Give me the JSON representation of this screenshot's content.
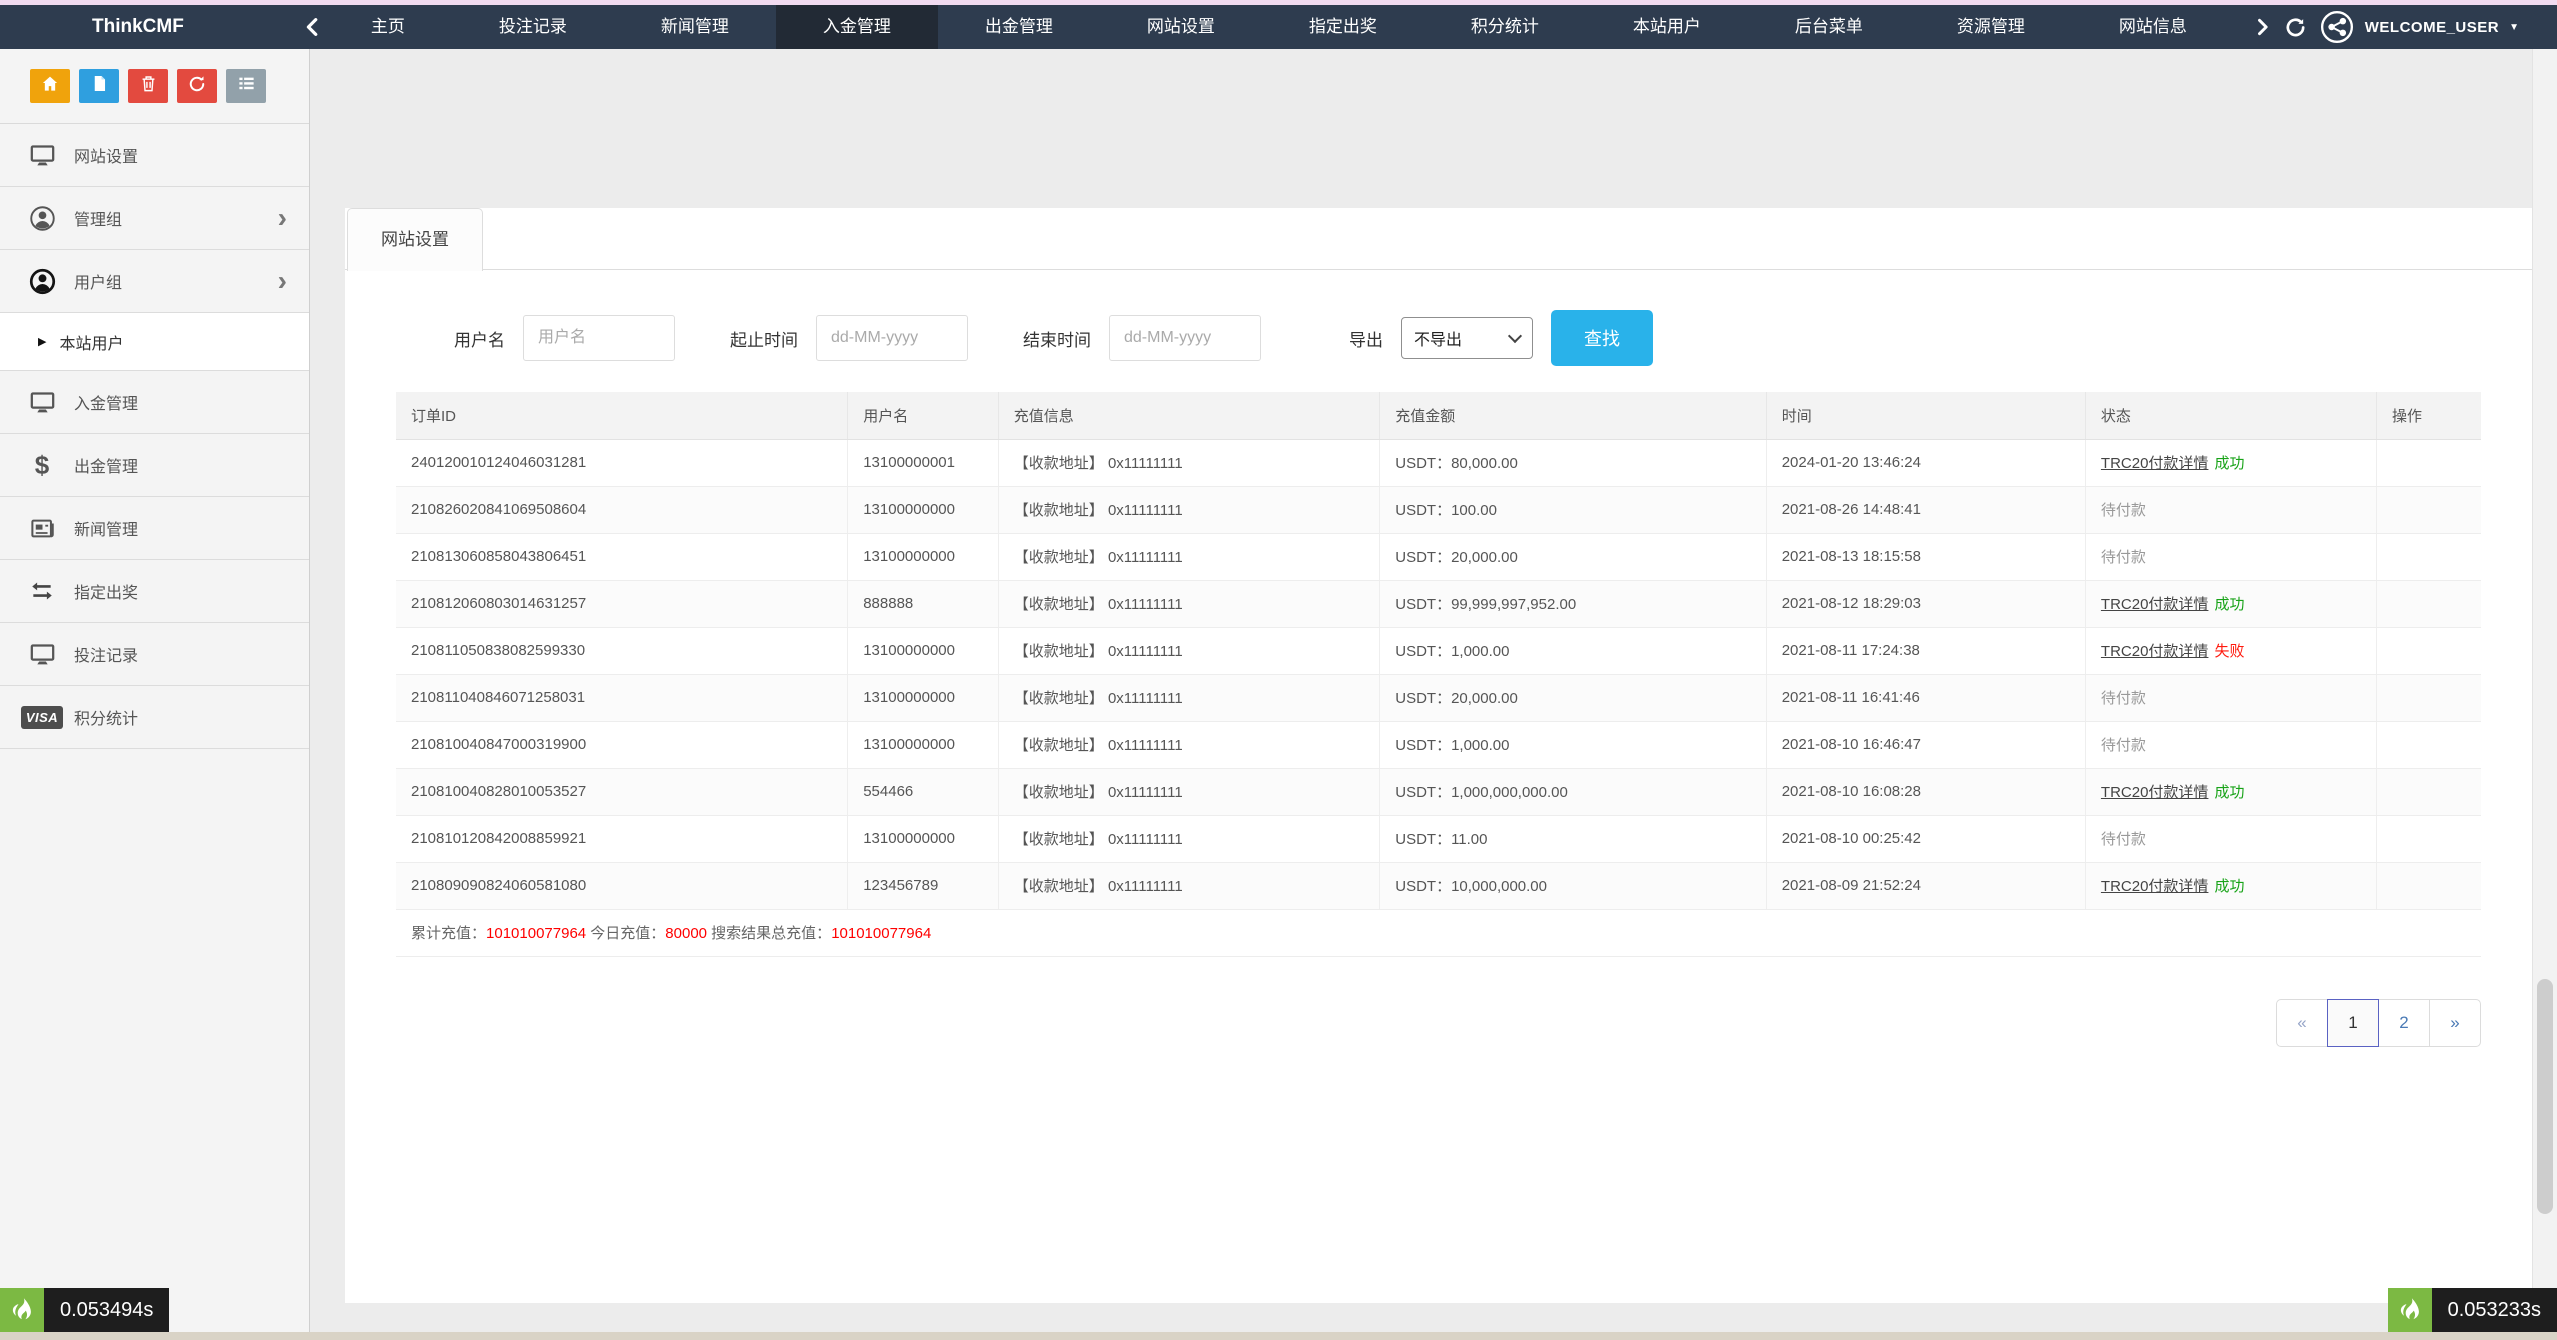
{
  "topnav": {
    "brand": "ThinkCMF",
    "items": [
      {
        "label": "主页",
        "active": false
      },
      {
        "label": "投注记录",
        "active": false
      },
      {
        "label": "新闻管理",
        "active": false
      },
      {
        "label": "入金管理",
        "active": true
      },
      {
        "label": "出金管理",
        "active": false
      },
      {
        "label": "网站设置",
        "active": false
      },
      {
        "label": "指定出奖",
        "active": false
      },
      {
        "label": "积分统计",
        "active": false
      },
      {
        "label": "本站用户",
        "active": false
      },
      {
        "label": "后台菜单",
        "active": false
      },
      {
        "label": "资源管理",
        "active": false
      },
      {
        "label": "网站信息",
        "active": false
      }
    ],
    "user": {
      "name": "WELCOME_USER",
      "caret": "▼"
    }
  },
  "sidebar": {
    "toolbar": [
      {
        "icon": "home-icon",
        "color": "#f0a30c"
      },
      {
        "icon": "file-icon",
        "color": "#2f9fdf"
      },
      {
        "icon": "trash-icon",
        "color": "#e34a3f"
      },
      {
        "icon": "recycle-icon",
        "color": "#e34a3f"
      },
      {
        "icon": "list-icon",
        "color": "#92a1aa"
      }
    ],
    "items": [
      {
        "icon": "monitor-icon",
        "label": "网站设置",
        "chevron": false,
        "sub": false,
        "active": false
      },
      {
        "icon": "user-circle-icon",
        "label": "管理组",
        "chevron": true,
        "sub": false,
        "active": false
      },
      {
        "icon": "user-circle-dark-icon",
        "label": "用户组",
        "chevron": true,
        "sub": false,
        "active": false
      },
      {
        "icon": "",
        "label": "本站用户",
        "chevron": false,
        "sub": true,
        "active": true
      },
      {
        "icon": "monitor-icon",
        "label": "入金管理",
        "chevron": false,
        "sub": false,
        "active": false
      },
      {
        "icon": "dollar-icon",
        "label": "出金管理",
        "chevron": false,
        "sub": false,
        "active": false
      },
      {
        "icon": "newspaper-icon",
        "label": "新闻管理",
        "chevron": false,
        "sub": false,
        "active": false
      },
      {
        "icon": "exchange-icon",
        "label": "指定出奖",
        "chevron": false,
        "sub": false,
        "active": false
      },
      {
        "icon": "monitor-icon",
        "label": "投注记录",
        "chevron": false,
        "sub": false,
        "active": false
      },
      {
        "icon": "visa-icon",
        "label": "积分统计",
        "chevron": false,
        "sub": false,
        "active": false
      }
    ]
  },
  "main": {
    "tab": "网站设置",
    "form": {
      "username_label": "用户名",
      "username_placeholder": "用户名",
      "start_label": "起止时间",
      "start_placeholder": "dd-MM-yyyy",
      "end_label": "结束时间",
      "end_placeholder": "dd-MM-yyyy",
      "export_label": "导出",
      "export_value": "不导出",
      "search_button": "查找"
    },
    "table": {
      "headers": [
        "订单ID",
        "用户名",
        "充值信息",
        "充值金额",
        "时间",
        "状态",
        "操作"
      ],
      "rows": [
        {
          "order_id": "240120010124046031281",
          "username": "13100000001",
          "info": "【收款地址】 0x11111111",
          "amount": "USDT：80,000.00",
          "time": "2024-01-20 13:46:24",
          "status": {
            "link": "TRC20付款详情",
            "result": "成功",
            "state": "success"
          }
        },
        {
          "order_id": "210826020841069508604",
          "username": "13100000000",
          "info": "【收款地址】 0x11111111",
          "amount": "USDT：100.00",
          "time": "2021-08-26 14:48:41",
          "status": {
            "link": null,
            "result": "待付款",
            "state": "pending"
          }
        },
        {
          "order_id": "210813060858043806451",
          "username": "13100000000",
          "info": "【收款地址】 0x11111111",
          "amount": "USDT：20,000.00",
          "time": "2021-08-13 18:15:58",
          "status": {
            "link": null,
            "result": "待付款",
            "state": "pending"
          }
        },
        {
          "order_id": "210812060803014631257",
          "username": "888888",
          "info": "【收款地址】 0x11111111",
          "amount": "USDT：99,999,997,952.00",
          "time": "2021-08-12 18:29:03",
          "status": {
            "link": "TRC20付款详情",
            "result": "成功",
            "state": "success"
          }
        },
        {
          "order_id": "210811050838082599330",
          "username": "13100000000",
          "info": "【收款地址】 0x11111111",
          "amount": "USDT：1,000.00",
          "time": "2021-08-11 17:24:38",
          "status": {
            "link": "TRC20付款详情",
            "result": "失败",
            "state": "fail"
          }
        },
        {
          "order_id": "210811040846071258031",
          "username": "13100000000",
          "info": "【收款地址】 0x11111111",
          "amount": "USDT：20,000.00",
          "time": "2021-08-11 16:41:46",
          "status": {
            "link": null,
            "result": "待付款",
            "state": "pending"
          }
        },
        {
          "order_id": "210810040847000319900",
          "username": "13100000000",
          "info": "【收款地址】 0x11111111",
          "amount": "USDT：1,000.00",
          "time": "2021-08-10 16:46:47",
          "status": {
            "link": null,
            "result": "待付款",
            "state": "pending"
          }
        },
        {
          "order_id": "210810040828010053527",
          "username": "554466",
          "info": "【收款地址】 0x11111111",
          "amount": "USDT：1,000,000,000.00",
          "time": "2021-08-10 16:08:28",
          "status": {
            "link": "TRC20付款详情",
            "result": "成功",
            "state": "success"
          }
        },
        {
          "order_id": "210810120842008859921",
          "username": "13100000000",
          "info": "【收款地址】 0x11111111",
          "amount": "USDT：11.00",
          "time": "2021-08-10 00:25:42",
          "status": {
            "link": null,
            "result": "待付款",
            "state": "pending"
          }
        },
        {
          "order_id": "210809090824060581080",
          "username": "123456789",
          "info": "【收款地址】 0x11111111",
          "amount": "USDT：10,000,000.00",
          "time": "2021-08-09 21:52:24",
          "status": {
            "link": "TRC20付款详情",
            "result": "成功",
            "state": "success"
          }
        }
      ]
    },
    "summary": [
      {
        "text": "累计充值：",
        "red": false
      },
      {
        "text": "101010077964",
        "red": true
      },
      {
        "text": " 今日充值：",
        "red": false
      },
      {
        "text": "80000",
        "red": true
      },
      {
        "text": " 搜索结果总充值：",
        "red": false
      },
      {
        "text": "101010077964",
        "red": true
      }
    ],
    "pagination": {
      "prev": "«",
      "pages": [
        {
          "label": "1",
          "active": true
        },
        {
          "label": "2",
          "active": false
        }
      ],
      "next": "»"
    }
  },
  "perf": {
    "left": "0.053494s",
    "right": "0.053233s"
  },
  "colors": {
    "topnav_bg": "#2e3c4f",
    "topnav_active_bg": "#222a35",
    "accent_blue": "#29b2ea",
    "success_green": "#18a318",
    "fail_red": "#ff1a0e",
    "summary_red": "#ff0000",
    "perf_green": "#7cb943"
  }
}
